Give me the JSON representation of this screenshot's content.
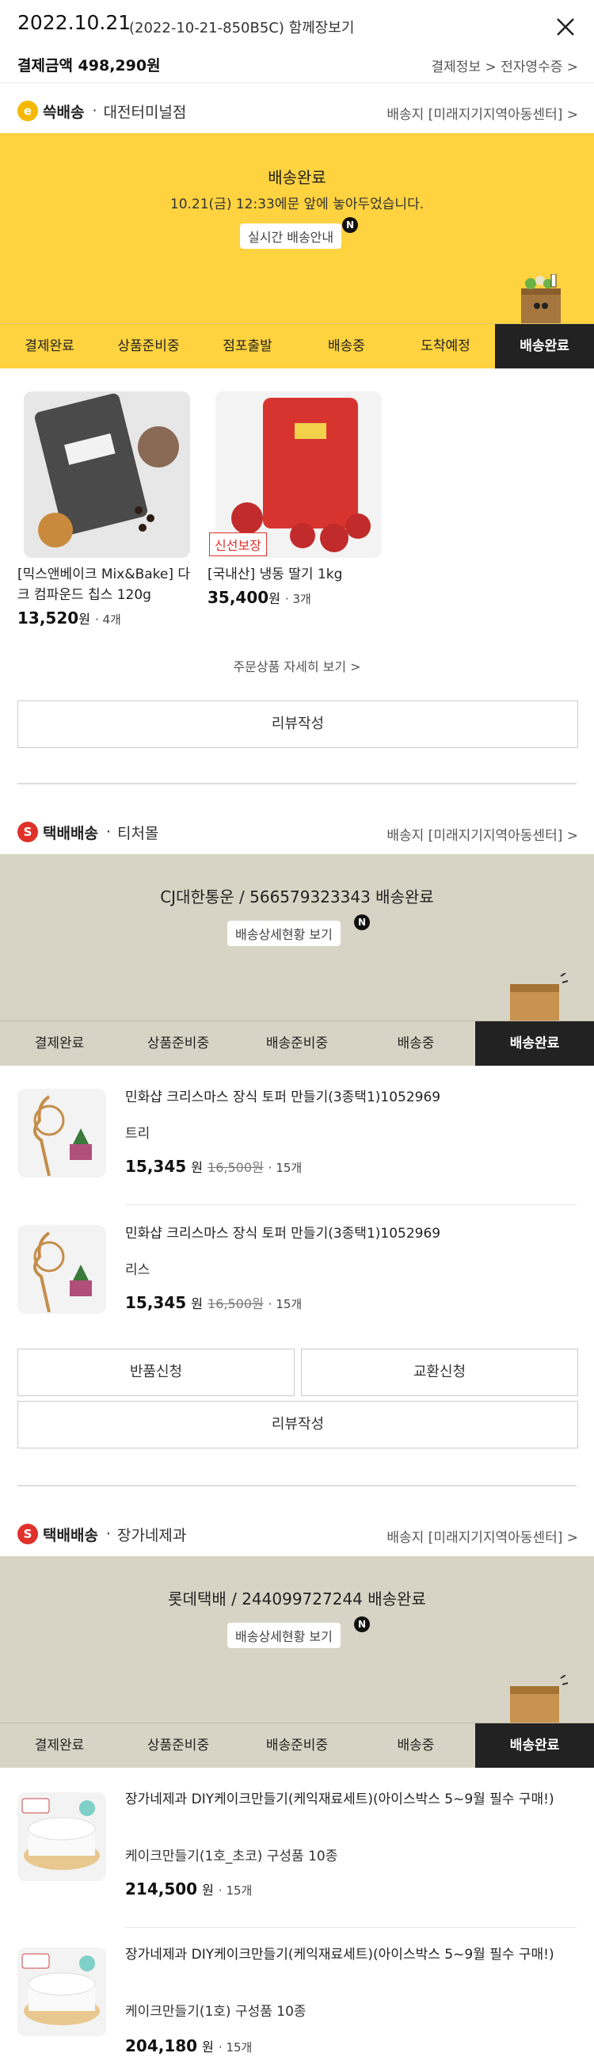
{
  "header": {
    "date": "2022.10.21",
    "order_no": "(2022-10-21-850B5C) 함께장보기",
    "pay_label": "결제금액 498,290원",
    "pay_links": "결제정보 > 전자영수증 >"
  },
  "sections": [
    {
      "badge": "e",
      "badge_color": "#f5b800",
      "name": "쓱배송",
      "store": "대전터미널점",
      "dest": "배송지 [미래지기지역아동센터] >",
      "status_title": "배송완료",
      "status_sub": "10.21(금) 12:33에문 앞에 놓아두었습니다.",
      "pill": "실시간 배송안내",
      "pill_badge": "N",
      "tabs": [
        "결제완료",
        "상품준비중",
        "점포출발",
        "배송중",
        "도착예정",
        "배송완료"
      ],
      "products": [
        {
          "name": "[믹스앤베이크 Mix&Bake] 다크 컴파운드 칩스 120g",
          "price": "13,520",
          "unit": "원",
          "qty": "· 4개"
        },
        {
          "name": "[국내산] 냉동 딸기 1kg",
          "tag": "신선보장",
          "price": "35,400",
          "unit": "원",
          "qty": "· 3개"
        }
      ],
      "detail_link": "주문상품 자세히 보기 >",
      "review_btn": "리뷰작성"
    },
    {
      "badge": "S",
      "badge_color": "#e0312a",
      "name": "택배배송",
      "store": "티처몰",
      "dest": "배송지 [미래지기지역아동센터] >",
      "status_title": "CJ대한통운 / 566579323343 배송완료",
      "pill": "배송상세현황 보기",
      "pill_badge": "N",
      "tabs": [
        "결제완료",
        "상품준비중",
        "배송준비중",
        "배송중",
        "배송완료"
      ],
      "products": [
        {
          "name": "민화샵 크리스마스 장식 토퍼 만들기(3종택1)1052969",
          "option": "트리",
          "price": "15,345",
          "unit": "원",
          "original": "16,500원",
          "qty": "· 15개"
        },
        {
          "name": "민화샵 크리스마스 장식 토퍼 만들기(3종택1)1052969",
          "option": "리스",
          "price": "15,345",
          "unit": "원",
          "original": "16,500원",
          "qty": "· 15개"
        }
      ],
      "return_btn": "반품신청",
      "exchange_btn": "교환신청",
      "review_btn": "리뷰작성"
    },
    {
      "badge": "S",
      "badge_color": "#e0312a",
      "name": "택배배송",
      "store": "장가네제과",
      "dest": "배송지 [미래지기지역아동센터] >",
      "status_title": "롯데택배 / 244099727244 배송완료",
      "pill": "배송상세현황 보기",
      "pill_badge": "N",
      "tabs": [
        "결제완료",
        "상품준비중",
        "배송준비중",
        "배송중",
        "배송완료"
      ],
      "products": [
        {
          "name": "장가네제과 DIY케이크만들기(케익재료세트)(아이스박스 5~9월 필수 구매!)",
          "option": "케이크만들기(1호_초코) 구성품 10종",
          "price": "214,500",
          "unit": "원",
          "qty": "· 15개"
        },
        {
          "name": "장가네제과 DIY케이크만들기(케익재료세트)(아이스박스 5~9월 필수 구매!)",
          "option": "케이크만들기(1호) 구성품 10종",
          "price": "204,180",
          "unit": "원",
          "qty": "· 15개"
        }
      ]
    }
  ]
}
